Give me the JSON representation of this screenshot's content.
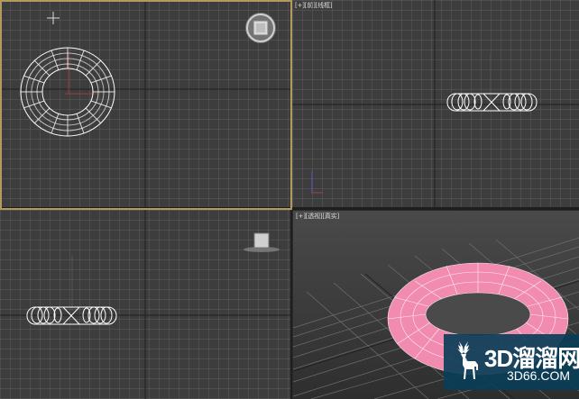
{
  "viewports": {
    "top": {
      "label_parts": []
    },
    "front": {
      "label_parts": [
        "[+]",
        "[前]",
        "[线框]"
      ]
    },
    "left": {
      "label_parts": []
    },
    "perspective": {
      "label_parts": [
        "[+]",
        "[透视]",
        "[真实]"
      ]
    }
  },
  "colors": {
    "viewport_bg": "#3d3d3d",
    "grid_line": "#6a6a6a",
    "grid_major": "#2a2a2a",
    "wireframe": "#ffffff",
    "active_border": "#b39a5c",
    "torus_shaded": "#f28bb0",
    "watermark_bg": "#0a3e58"
  },
  "icons": {
    "viewcube": "viewcube-icon",
    "cursor": "crosshair-cursor-icon",
    "deer_logo": "deer-logo-icon"
  },
  "watermark": {
    "brand": "3D溜溜网",
    "site": "3D66.COM"
  }
}
